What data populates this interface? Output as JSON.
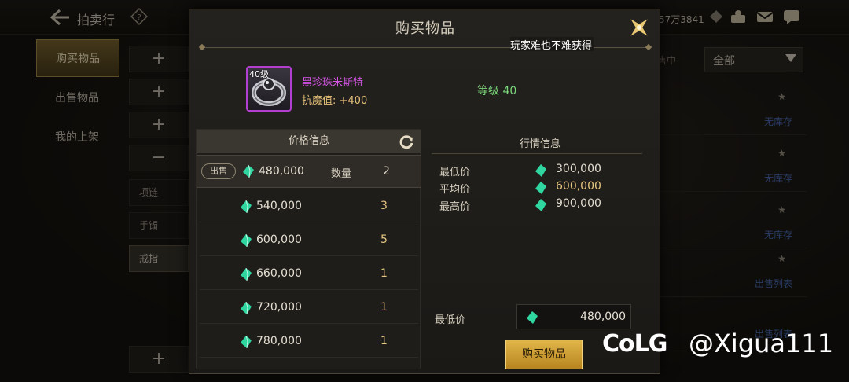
{
  "topbar": {
    "title": "拍卖行",
    "currency": "57万3841"
  },
  "leftnav": {
    "items": [
      {
        "label": "购买物品",
        "active": true
      },
      {
        "label": "出售物品",
        "active": false
      },
      {
        "label": "我的上架",
        "active": false
      }
    ]
  },
  "categories": {
    "expand_symbol": "+",
    "collapse_symbol": "−",
    "items": [
      "项链",
      "手镯",
      "戒指"
    ]
  },
  "right_area": {
    "tag": "售中",
    "filter_value": "全部",
    "rows": [
      "无库存",
      "无库存",
      "无库存",
      "出售列表",
      "出售列表"
    ]
  },
  "modal": {
    "title": "购买物品",
    "marquee": "玩家难也不难获得",
    "item": {
      "level_tag": "40级",
      "name": "黑珍珠米斯特",
      "stat": "抗魔值: +400",
      "level_requirement": "等级 40",
      "frame_color": "#b23fd0"
    },
    "price_panel": {
      "header": "价格信息",
      "sell_label": "出售",
      "qty_label": "数量",
      "rows": [
        {
          "price": "480,000",
          "qty": "2"
        },
        {
          "price": "540,000",
          "qty": "3"
        },
        {
          "price": "600,000",
          "qty": "5"
        },
        {
          "price": "660,000",
          "qty": "1"
        },
        {
          "price": "720,000",
          "qty": "1"
        },
        {
          "price": "780,000",
          "qty": "1"
        }
      ]
    },
    "market_panel": {
      "header": "行情信息",
      "min_label": "最低价",
      "min_value": "300,000",
      "avg_label": "平均价",
      "avg_value": "600,000",
      "max_label": "最高价",
      "max_value": "900,000",
      "lowest_label": "最低价",
      "lowest_value": "480,000",
      "buy_button": "购买物品"
    }
  },
  "watermark": {
    "logo": "CoLG",
    "handle": "@Xigua111"
  },
  "colors": {
    "accent_gold": "#e1b64a",
    "gem_green": "#2fd6a0",
    "epic_purple": "#d455e6"
  }
}
